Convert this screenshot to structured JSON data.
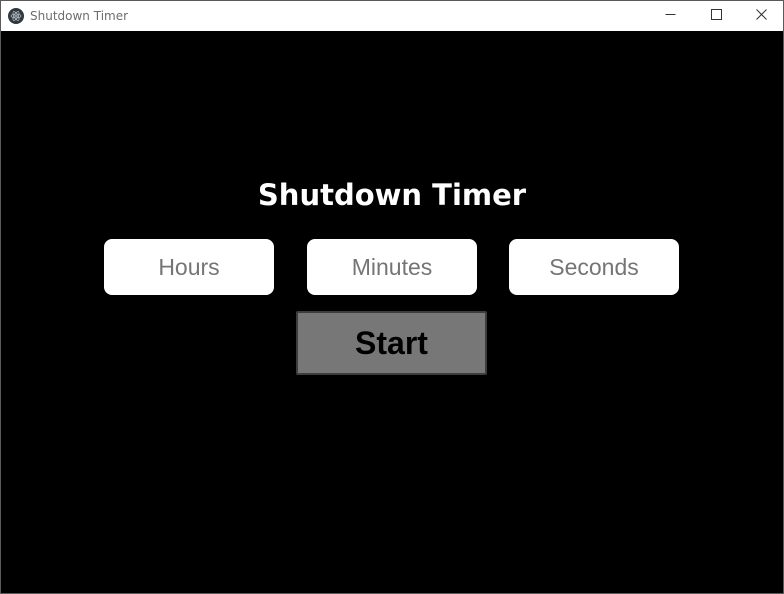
{
  "window": {
    "title": "Shutdown Timer",
    "app_icon": "electron-atom-icon",
    "controls": {
      "minimize_icon": "minimize-icon",
      "maximize_icon": "maximize-icon",
      "close_icon": "close-icon"
    }
  },
  "main": {
    "heading": "Shutdown Timer",
    "inputs": {
      "hours": {
        "placeholder": "Hours",
        "value": ""
      },
      "minutes": {
        "placeholder": "Minutes",
        "value": ""
      },
      "seconds": {
        "placeholder": "Seconds",
        "value": ""
      }
    },
    "start_label": "Start"
  },
  "colors": {
    "background": "#000000",
    "titlebar": "#ffffff",
    "input_background": "#ffffff",
    "button_background": "#777777",
    "heading_text": "#ffffff"
  }
}
